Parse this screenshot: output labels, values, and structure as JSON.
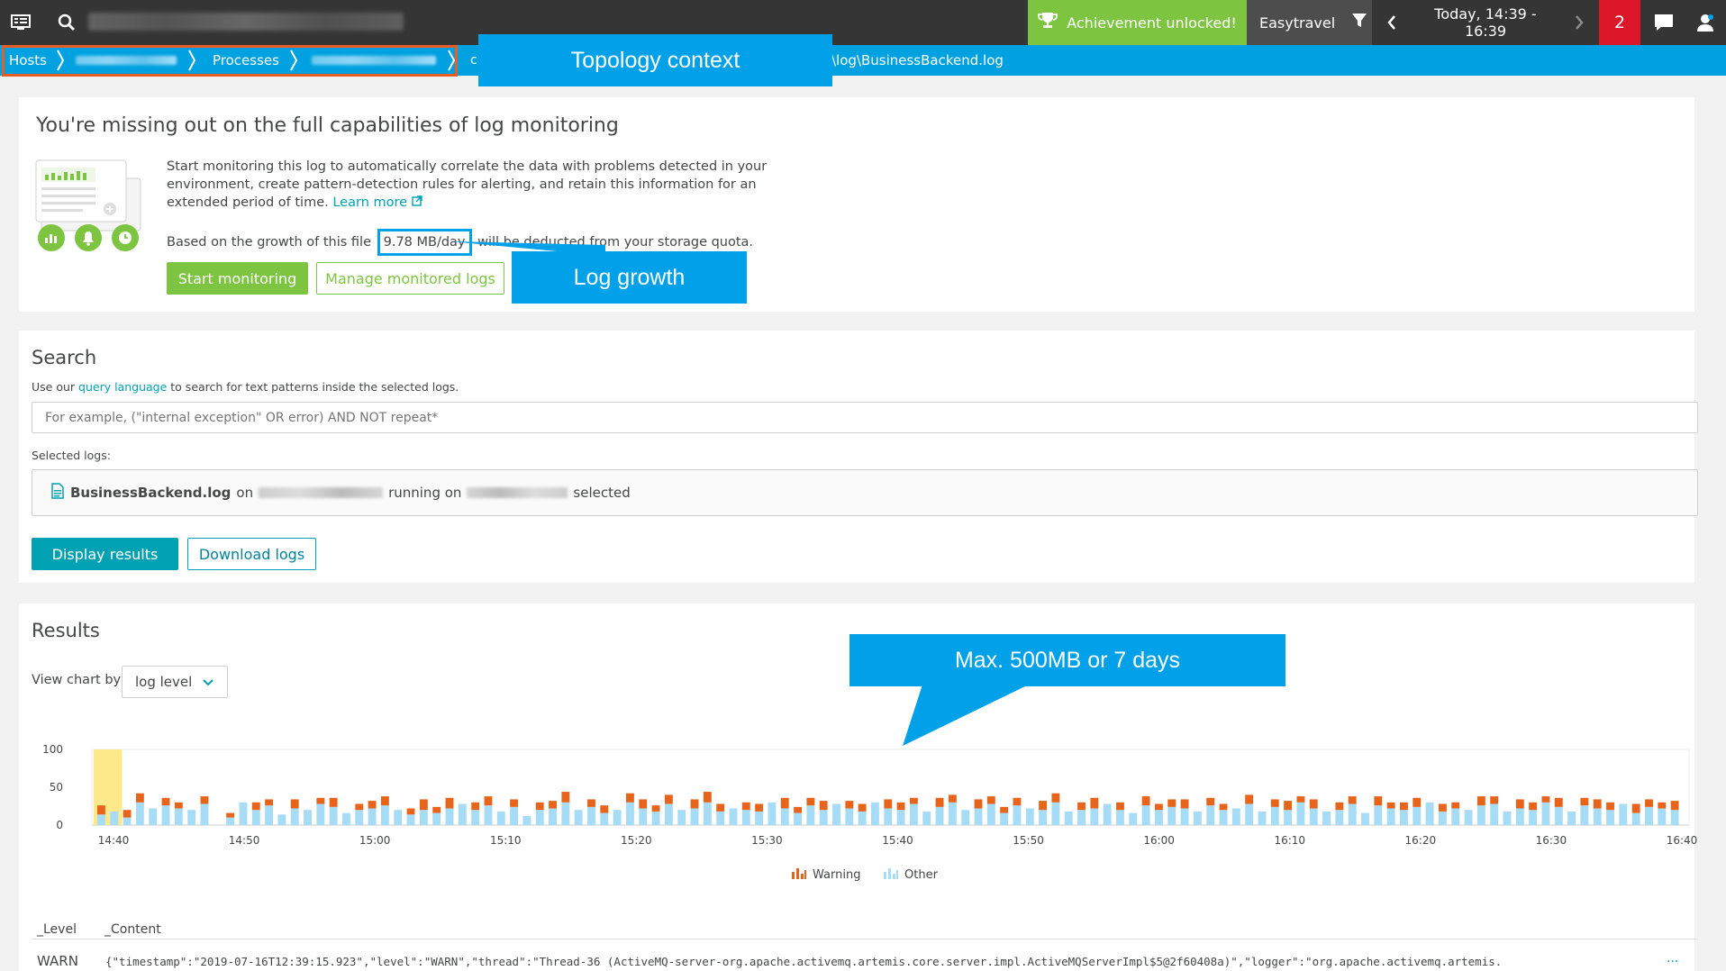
{
  "topbar": {
    "achievement_label": "Achievement unlocked!",
    "filter_label": "Easytravel",
    "timeframe_label": "Today, 14:39 - 16:39",
    "problem_count": "2"
  },
  "breadcrumb": {
    "hosts": "Hosts",
    "processes": "Processes",
    "path_prefix": "c:",
    "path_suffix": "\\log\\BusinessBackend.log"
  },
  "callouts": {
    "topology": "Topology context",
    "log_growth": "Log growth",
    "retention": "Max. 500MB or 7 days"
  },
  "upsell": {
    "title": "You're missing out on the full capabilities of log monitoring",
    "desc_line1": "Start monitoring this log to automatically correlate the data with problems detected in your",
    "desc_line2": "environment, create pattern-detection rules for alerting, and retain this information for an",
    "desc_line3": "extended period of time.",
    "learn_more": "Learn more",
    "growth_prefix": "Based on the growth of this file",
    "growth_value": "9.78 MB/day",
    "growth_suffix": "will be deducted from your storage quota.",
    "start_button": "Start monitoring",
    "manage_button": "Manage monitored logs"
  },
  "search": {
    "title": "Search",
    "help_prefix": "Use our",
    "help_link": "query language",
    "help_suffix": "to search for text patterns inside the selected logs.",
    "placeholder": "For example, (\"internal exception\" OR error) AND NOT repeat*",
    "selected_label": "Selected logs:",
    "log_name": "BusinessBackend.log",
    "on_word": "on",
    "running_on": "running on",
    "selected_word": "selected",
    "display_button": "Display results",
    "download_button": "Download logs"
  },
  "results": {
    "title": "Results",
    "view_by_label": "View chart by",
    "view_by_value": "log level",
    "col_level": "_Level",
    "col_content": "_Content",
    "row_level": "WARN",
    "row_content": "{\"timestamp\":\"2019-07-16T12:39:15.923\",\"level\":\"WARN\",\"thread\":\"Thread-36 (ActiveMQ-server-org.apache.activemq.artemis.core.server.impl.ActiveMQServerImpl$5@2f60408a)\",\"logger\":\"org.apache.activemq.artemis.",
    "row_more": "..."
  },
  "chart_data": {
    "type": "bar",
    "stacked": true,
    "yticks": [
      "0",
      "50",
      "100"
    ],
    "ylim": [
      0,
      100
    ],
    "xticks": [
      "14:40",
      "14:50",
      "15:00",
      "15:10",
      "15:20",
      "15:30",
      "15:40",
      "15:50",
      "16:00",
      "16:10",
      "16:20",
      "16:30",
      "16:40"
    ],
    "legend": [
      "Warning",
      "Other"
    ],
    "colors": {
      "warning": "#e8641b",
      "other": "#a6dcf6",
      "highlight": "#fde98a"
    },
    "series": [
      {
        "name": "Warning",
        "values": [
          12,
          0,
          10,
          12,
          0,
          10,
          8,
          0,
          10,
          0,
          6,
          0,
          10,
          8,
          0,
          12,
          0,
          8,
          12,
          0,
          8,
          10,
          12,
          0,
          8,
          14,
          8,
          14,
          0,
          10,
          12,
          0,
          10,
          0,
          10,
          10,
          14,
          0,
          10,
          10,
          0,
          12,
          12,
          8,
          12,
          0,
          12,
          14,
          10,
          0,
          10,
          10,
          0,
          14,
          8,
          10,
          12,
          0,
          10,
          10,
          0,
          12,
          10,
          8,
          0,
          12,
          10,
          0,
          12,
          10,
          8,
          10,
          0,
          12,
          12,
          0,
          10,
          14,
          0,
          10,
          0,
          12,
          8,
          10,
          12,
          0,
          10,
          8,
          0,
          12,
          0,
          10,
          12,
          8,
          12,
          0,
          10,
          10,
          0,
          12,
          8,
          10,
          12,
          0,
          10,
          8,
          0,
          12,
          10,
          0,
          12,
          10,
          8,
          12,
          0,
          10,
          12,
          10,
          0,
          12,
          10,
          8,
          12
        ]
      },
      {
        "name": "Other",
        "values": [
          14,
          18,
          10,
          30,
          22,
          26,
          22,
          20,
          28,
          0,
          10,
          30,
          20,
          26,
          14,
          22,
          20,
          28,
          24,
          16,
          20,
          22,
          26,
          20,
          14,
          20,
          16,
          22,
          28,
          20,
          26,
          18,
          24,
          12,
          20,
          22,
          30,
          20,
          24,
          16,
          20,
          30,
          22,
          18,
          28,
          20,
          22,
          30,
          18,
          22,
          20,
          18,
          30,
          22,
          16,
          26,
          20,
          28,
          22,
          18,
          30,
          22,
          20,
          28,
          18,
          24,
          30,
          20,
          22,
          28,
          16,
          26,
          22,
          20,
          30,
          18,
          20,
          22,
          28,
          20,
          16,
          26,
          20,
          24,
          22,
          18,
          26,
          20,
          22,
          28,
          18,
          24,
          20,
          30,
          22,
          18,
          20,
          28,
          16,
          26,
          22,
          20,
          24,
          30,
          18,
          22,
          20,
          26,
          28,
          18,
          22,
          20,
          30,
          24,
          18,
          26,
          22,
          20,
          28,
          16,
          24,
          22,
          20,
          26
        ]
      }
    ]
  }
}
